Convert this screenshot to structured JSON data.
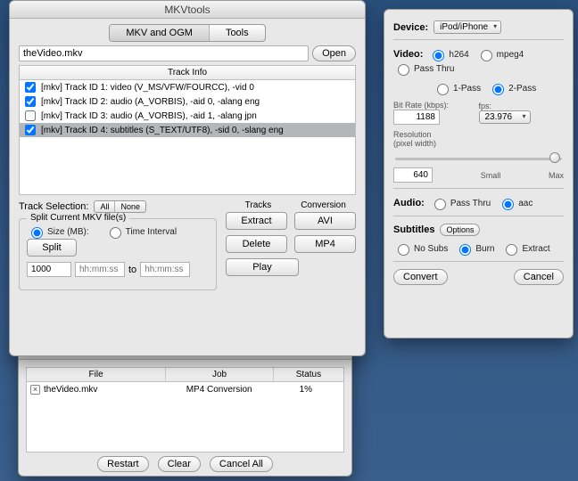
{
  "app": {
    "title": "MKVtools"
  },
  "tabs": {
    "main": "MKV and OGM",
    "tools": "Tools"
  },
  "file": {
    "name": "theVideo.mkv",
    "open": "Open"
  },
  "trackinfo": {
    "header": "Track Info",
    "rows": [
      {
        "checked": true,
        "text": "[mkv] Track ID 1: video (V_MS/VFW/FOURCC), -vid 0"
      },
      {
        "checked": true,
        "text": "[mkv] Track ID 2: audio (A_VORBIS), -aid 0, -alang eng"
      },
      {
        "checked": false,
        "text": "[mkv] Track ID 3: audio (A_VORBIS), -aid 1, -alang jpn"
      },
      {
        "checked": true,
        "text": "[mkv] Track ID 4: subtitles (S_TEXT/UTF8), -sid 0, -slang eng"
      }
    ]
  },
  "trackselect": {
    "label": "Track Selection:",
    "all": "All",
    "none": "None"
  },
  "split": {
    "title": "Split Current MKV file(s)",
    "btn": "Split",
    "size_label": "Size (MB):",
    "time_label": "Time Interval",
    "size_value": "1000",
    "to": "to",
    "hh": "hh:mm:ss"
  },
  "actions": {
    "tracks_hdr": "Tracks",
    "conv_hdr": "Conversion",
    "extract": "Extract",
    "delete": "Delete",
    "play": "Play",
    "avi": "AVI",
    "mp4": "MP4"
  },
  "settings": {
    "device": {
      "label": "Device:",
      "value": "iPod/iPhone"
    },
    "video": {
      "label": "Video:",
      "h264": "h264",
      "mpeg4": "mpeg4",
      "passthru": "Pass Thru",
      "one": "1-Pass",
      "two": "2-Pass",
      "bitrate_label": "Bit Rate (kbps):",
      "bitrate": "1188",
      "fps_label": "fps:",
      "fps": "23.976",
      "res_label": "Resolution",
      "res_sub": "(pixel width)",
      "res_value": "640",
      "small": "Small",
      "max": "Max"
    },
    "audio": {
      "label": "Audio:",
      "passthru": "Pass Thru",
      "aac": "aac"
    },
    "subs": {
      "label": "Subtitles",
      "options": "Options",
      "nosubs": "No Subs",
      "burn": "Burn",
      "extract": "Extract"
    },
    "convert": "Convert",
    "cancel": "Cancel"
  },
  "jobs": {
    "file_hdr": "File",
    "job_hdr": "Job",
    "status_hdr": "Status",
    "rows": [
      {
        "file": "theVideo.mkv",
        "job": "MP4 Conversion",
        "status": "1%"
      }
    ],
    "restart": "Restart",
    "clear": "Clear",
    "cancel_all": "Cancel All"
  }
}
